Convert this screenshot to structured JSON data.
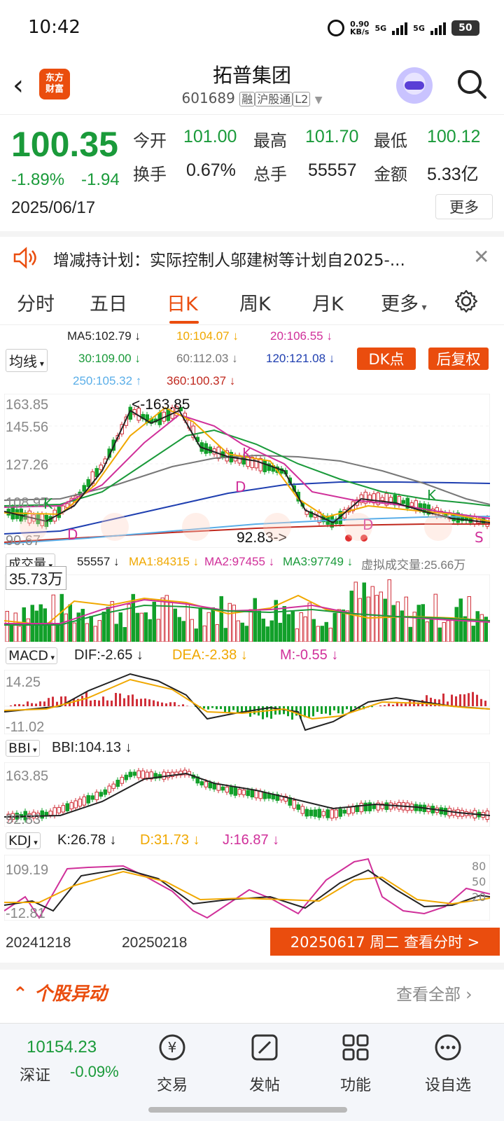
{
  "status": {
    "time": "10:42",
    "speed": "0.90",
    "speed_unit": "KB/s",
    "net1": "5G",
    "net2": "5G",
    "battery": "50"
  },
  "header": {
    "title": "拓普集团",
    "code": "601689",
    "tag1": "融",
    "tag2": "沪股通",
    "tag3": "L2",
    "logo_line1": "东方",
    "logo_line2": "财富"
  },
  "quote": {
    "price": "100.35",
    "change_pct": "-1.89%",
    "change": "-1.94",
    "date": "2025/06/17",
    "open_label": "今开",
    "open": "101.00",
    "high_label": "最高",
    "high": "101.70",
    "low_label": "最低",
    "low": "100.12",
    "turnover_label": "换手",
    "turnover": "0.67%",
    "volume_label": "总手",
    "volume": "55557",
    "amount_label": "金额",
    "amount": "5.33亿",
    "more": "更多"
  },
  "notice": {
    "text": "增减持计划：实际控制人邬建树等计划自2025-..."
  },
  "tabs": [
    "分时",
    "五日",
    "日K",
    "周K",
    "月K",
    "更多"
  ],
  "active_tab": "日K",
  "ma": {
    "selector": "均线",
    "ma5": "MA5:102.79 ↓",
    "ma10": "10:104.07 ↓",
    "ma20": "20:106.55 ↓",
    "ma30": "30:109.00 ↓",
    "ma60": "60:112.03 ↓",
    "ma120": "120:121.08 ↓",
    "ma250": "250:105.32 ↑",
    "ma360": "360:100.37 ↓",
    "dk_button": "DK点",
    "adjust_button": "后复权",
    "colors": {
      "ma5": "#222222",
      "ma10": "#f0a800",
      "ma20": "#d0309a",
      "ma30": "#1a9a3a",
      "ma60": "#777777",
      "ma120": "#1f3fb0",
      "ma250": "#5aaee8",
      "ma360": "#c0281e"
    }
  },
  "kline": {
    "axis_top": "163.85",
    "axis_2": "145.56",
    "axis_3": "127.26",
    "axis_4": "108.97",
    "axis_bottom": "90.67",
    "high_marker": "<-163.85",
    "low_marker": "92.83->",
    "k_letter": "K",
    "d_letter": "D",
    "s_letter": "S"
  },
  "volume": {
    "selector": "成交量",
    "current": "55557 ↓",
    "ma1": "MA1:84315 ↓",
    "ma2": "MA2:97455 ↓",
    "ma3": "MA3:97749 ↓",
    "virtual": "虚拟成交量:25.66万",
    "axis_top": "35.73万",
    "axis_tag": "35.73万"
  },
  "macd": {
    "selector": "MACD",
    "dif": "DIF:-2.65 ↓",
    "dea": "DEA:-2.38 ↓",
    "m": "M:-0.55 ↓",
    "axis_top": "14.25",
    "axis_bottom": "-11.02"
  },
  "bbi": {
    "selector": "BBI",
    "value": "BBI:104.13 ↓",
    "axis_top": "163.85",
    "axis_bottom": "92.83"
  },
  "kdj": {
    "selector": "KDJ",
    "k": "K:26.78 ↓",
    "d": "D:31.73 ↓",
    "j": "J:16.87 ↓",
    "axis_top": "109.19",
    "axis_bottom": "-12.81",
    "r80": "80",
    "r50": "50",
    "r20": "20"
  },
  "dates": {
    "d1": "20241218",
    "d2": "20250218"
  },
  "cta": "20250617 周二 查看分时 >",
  "section": {
    "title": "个股异动",
    "link": "查看全部"
  },
  "bottom": {
    "index_value": "10154.23",
    "index_name": "深证",
    "index_change": "-0.09%",
    "nav": [
      "交易",
      "发帖",
      "功能",
      "设自选"
    ]
  }
}
